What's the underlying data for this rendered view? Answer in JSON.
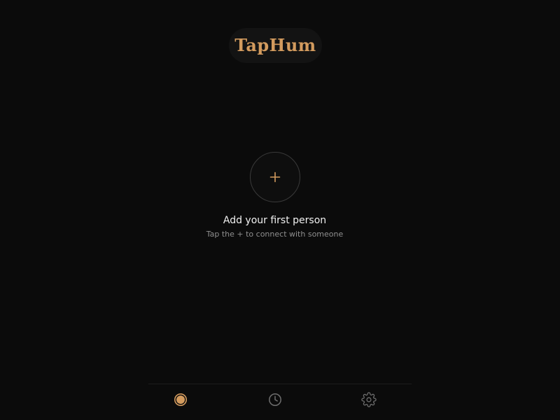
{
  "header": {
    "brand_name": "TapHum"
  },
  "empty_state": {
    "add_icon": "plus-icon",
    "title": "Add your first person",
    "subtitle": "Tap the + to connect with someone"
  },
  "bottom_nav": {
    "items": [
      {
        "id": "home",
        "icon": "circle-dot-icon",
        "active": true
      },
      {
        "id": "history",
        "icon": "clock-icon",
        "active": false
      },
      {
        "id": "settings",
        "icon": "gear-icon",
        "active": false
      }
    ]
  },
  "colors": {
    "background": "#0b0b0b",
    "accent": "#d39b5e",
    "icon_inactive": "#6e6e6e",
    "text_primary": "#f2f2f2",
    "text_secondary": "#8f8f8f"
  }
}
